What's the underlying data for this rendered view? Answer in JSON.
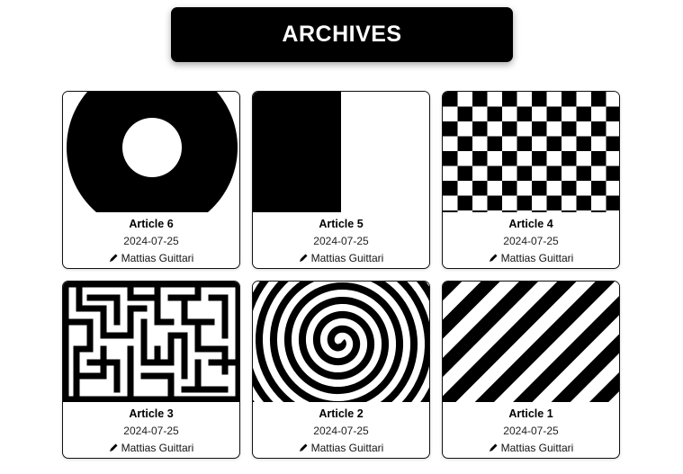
{
  "page": {
    "title": "ARCHIVES"
  },
  "articles": [
    {
      "title": "Article 6",
      "date": "2024-07-25",
      "author": "Mattias Guittari",
      "thumbnail": "ring-pattern"
    },
    {
      "title": "Article 5",
      "date": "2024-07-25",
      "author": "Mattias Guittari",
      "thumbnail": "half-block-pattern"
    },
    {
      "title": "Article 4",
      "date": "2024-07-25",
      "author": "Mattias Guittari",
      "thumbnail": "checkerboard-pattern"
    },
    {
      "title": "Article 3",
      "date": "2024-07-25",
      "author": "Mattias Guittari",
      "thumbnail": "maze-pattern"
    },
    {
      "title": "Article 2",
      "date": "2024-07-25",
      "author": "Mattias Guittari",
      "thumbnail": "spiral-pattern"
    },
    {
      "title": "Article 1",
      "date": "2024-07-25",
      "author": "Mattias Guittari",
      "thumbnail": "diagonal-stripes-pattern"
    }
  ],
  "icons": {
    "author": "pen-icon"
  },
  "colors": {
    "primary": "#000000",
    "background": "#ffffff"
  }
}
